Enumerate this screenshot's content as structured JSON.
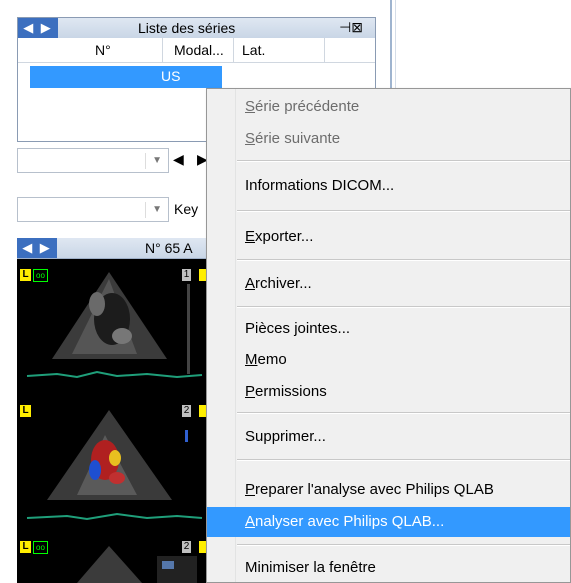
{
  "series_panel": {
    "nav_arrows": "◀ ▶",
    "title": "Liste des séries",
    "pin_icon": "⊣⊠",
    "columns": [
      "N°",
      "Modal...",
      "Lat."
    ],
    "selected_row": {
      "modality": "US"
    }
  },
  "controls": {
    "combo1_value": "",
    "prev_label": "◀",
    "next_label": "▶",
    "combo2_value": "",
    "key_label": "Key"
  },
  "viewer": {
    "nav_arrows": "◀ ▶",
    "title": "N° 65 A",
    "thumbnails": [
      {
        "tag_l": "L",
        "tag_cam": "oo",
        "number": "1"
      },
      {
        "tag_l": "L",
        "number": "2"
      },
      {
        "tag_l": "L",
        "tag_cam": "oo",
        "number": "2"
      }
    ]
  },
  "context_menu": {
    "items": [
      {
        "label": "Série précédente",
        "accel": "S",
        "rest": "érie précédente",
        "enabled": false
      },
      {
        "label": "Série suivante",
        "accel": "S",
        "rest": "érie suivante",
        "enabled": false
      },
      {
        "label": "Informations DICOM...",
        "accel": "",
        "rest": "Informations DICOM...",
        "enabled": true
      },
      {
        "label": "Exporter...",
        "accel": "E",
        "rest": "xporter...",
        "enabled": true
      },
      {
        "label": "Archiver...",
        "accel": "A",
        "rest": "rchiver...",
        "enabled": true
      },
      {
        "label": "Pièces jointes...",
        "accel": "",
        "rest": "Pièces jointes...",
        "enabled": true
      },
      {
        "label": "Memo",
        "accel": "M",
        "rest": "emo",
        "enabled": true
      },
      {
        "label": "Permissions",
        "accel": "P",
        "rest": "ermissions",
        "enabled": true
      },
      {
        "label": "Supprimer...",
        "accel": "",
        "rest": "Supprimer...",
        "enabled": true
      },
      {
        "label": "Preparer l'analyse avec Philips QLAB",
        "accel": "P",
        "rest": "reparer l'analyse avec Philips QLAB",
        "enabled": true
      },
      {
        "label": "Analyser avec Philips QLAB...",
        "accel": "A",
        "rest": "nalyser avec Philips QLAB...",
        "enabled": true,
        "highlighted": true
      },
      {
        "label": "Minimiser la fenêtre",
        "accel": "",
        "rest": "Minimiser la fenêtre",
        "enabled": true
      }
    ]
  },
  "colors": {
    "selection": "#3399ff",
    "menu_bg": "#f0f0f0",
    "tag_yellow": "#ffee00",
    "tag_green": "#00ff00"
  }
}
